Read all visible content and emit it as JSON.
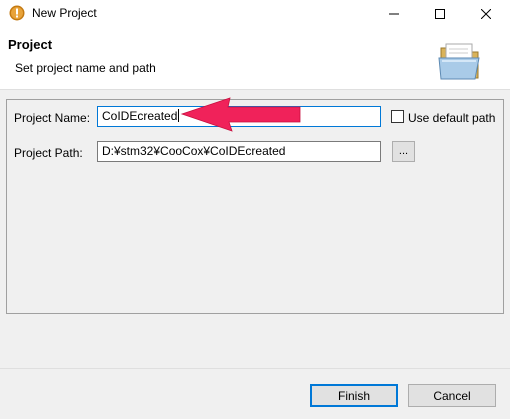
{
  "window": {
    "title": "New Project",
    "icon": "info-icon",
    "controls": [
      "minimize-icon",
      "maximize-icon",
      "close-icon"
    ]
  },
  "header": {
    "title": "Project",
    "subtitle": "Set project name and path",
    "icon": "folder-icon"
  },
  "form": {
    "name_label": "Project Name:",
    "name_value": "CoIDEcreated",
    "default_path_label": "Use default path",
    "default_path_checked": false,
    "path_label": "Project Path:",
    "path_value": "D:¥stm32¥CooCox¥CoIDEcreated",
    "browse_label": "..."
  },
  "footer": {
    "finish_label": "Finish",
    "cancel_label": "Cancel"
  },
  "colors": {
    "focus_border": "#0078d7",
    "annotation_arrow": "#f0225a"
  }
}
